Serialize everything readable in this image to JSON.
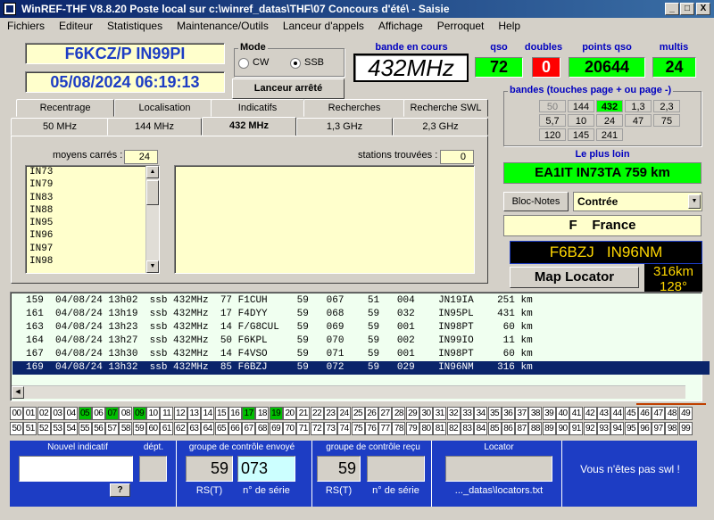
{
  "window": {
    "title": "WinREF-THF V8.8.20 Poste local sur c:\\winref_datas\\THF\\07 Concours d'été\\ -  Saisie",
    "minimize": "_",
    "maximize": "□",
    "close": "X"
  },
  "menu": [
    "Fichiers",
    "Editeur",
    "Statistiques",
    "Maintenance/Outils",
    "Lanceur d'appels",
    "Affichage",
    "Perroquet",
    "Help"
  ],
  "station": {
    "callsign": "F6KCZ/P  IN99PI",
    "datetime": "05/08/2024   06:19:13"
  },
  "mode": {
    "label": "Mode",
    "options": [
      "CW",
      "SSB"
    ],
    "selected": "SSB"
  },
  "launcher_button": "Lanceur arrêté",
  "stats": {
    "band_label": "bande en cours",
    "band": "432MHz",
    "qso_label": "qso",
    "qso": "72",
    "dup_label": "doubles",
    "dup": "0",
    "points_label": "points qso",
    "points": "20644",
    "multi_label": "multis",
    "multi": "24"
  },
  "bands": {
    "label": "bandes (touches page + ou page -)",
    "rows": [
      [
        "50",
        "144",
        "432",
        "1,3",
        "2,3"
      ],
      [
        "5,7",
        "10",
        "24",
        "47",
        "75"
      ],
      [
        "120",
        "145",
        "241"
      ]
    ],
    "active": "432"
  },
  "farthest": {
    "label": "Le plus loin",
    "value": "EA1IT IN73TA  759 km"
  },
  "notes_button": "Bloc-Notes",
  "country_select": "Contrée",
  "country": "F    France",
  "last_station": "F6BZJ   IN96NM",
  "map_button": "Map Locator",
  "distance": "316km",
  "azimuth": "128°",
  "tabs_top": [
    "Recentrage",
    "Localisation",
    "Indicatifs",
    "Recherches",
    "Recherche SWL"
  ],
  "tabs_bottom": [
    "50 MHz",
    "144 MHz",
    "432 MHz",
    "1,3 GHz",
    "2,3 GHz"
  ],
  "tab_active": "432 MHz",
  "squares": {
    "label": "moyens carrés :",
    "count": "24",
    "items": [
      "IN73",
      "IN79",
      "IN83",
      "IN88",
      "IN95",
      "IN96",
      "IN97",
      "IN98"
    ]
  },
  "found": {
    "label": "stations trouvées :",
    "count": "0"
  },
  "log": [
    "159  04/08/24 13h02  ssb 432MHz  77 F1CUH     59   067    51   004    JN19IA    251 km",
    "161  04/08/24 13h19  ssb 432MHz  17 F4DYY     59   068    59   032    IN95PL    431 km",
    "163  04/08/24 13h23  ssb 432MHz  14 F/G8CUL   59   069    59   001    IN98PT     60 km",
    "164  04/08/24 13h27  ssb 432MHz  50 F6KPL     59   070    59   002    IN99IO     11 km",
    "167  04/08/24 13h30  ssb 432MHz  14 F4VSO     59   071    59   001    IN98PT     60 km",
    "169  04/08/24 13h32  ssb 432MHz  85 F6BZJ     59   072    59   029    IN96NM    316 km"
  ],
  "numbers_row1": [
    "00",
    "01",
    "02",
    "03",
    "04",
    "05",
    "06",
    "07",
    "08",
    "09",
    "10",
    "11",
    "12",
    "13",
    "14",
    "15",
    "16",
    "17",
    "18",
    "19",
    "20",
    "21",
    "22",
    "23",
    "24",
    "25",
    "26",
    "27",
    "28",
    "29",
    "30",
    "31",
    "32",
    "33",
    "34",
    "35",
    "36",
    "37",
    "38",
    "39",
    "40",
    "41",
    "42",
    "43",
    "44",
    "45",
    "46",
    "47",
    "48",
    "49"
  ],
  "numbers_row2": [
    "50",
    "51",
    "52",
    "53",
    "54",
    "55",
    "56",
    "57",
    "58",
    "59",
    "60",
    "61",
    "62",
    "63",
    "64",
    "65",
    "66",
    "67",
    "68",
    "69",
    "70",
    "71",
    "72",
    "73",
    "74",
    "75",
    "76",
    "77",
    "78",
    "79",
    "80",
    "81",
    "82",
    "83",
    "84",
    "85",
    "86",
    "87",
    "88",
    "89",
    "90",
    "91",
    "92",
    "93",
    "94",
    "95",
    "96",
    "97",
    "98",
    "99"
  ],
  "numbers_on": [
    "05",
    "07",
    "09",
    "17",
    "19"
  ],
  "entry": {
    "callsign_label": "Nouvel indicatif",
    "dept_label": "dépt.",
    "help": "?",
    "sent_label": "groupe de contrôle envoyé",
    "sent_rst": "59",
    "sent_serial": "073",
    "recv_label": "groupe de contrôle reçu",
    "recv_rst": "59",
    "rst_label": "RS(T)",
    "serial_label": "n° de série",
    "locator_label": "Locator",
    "locator_file": "..._datas\\locators.txt",
    "swl_msg": "Vous n'êtes pas swl !"
  },
  "colors": {
    "accent": "#1d3dc4",
    "title": "#0a246a",
    "green": "#00ff00",
    "red": "#ff0000"
  }
}
